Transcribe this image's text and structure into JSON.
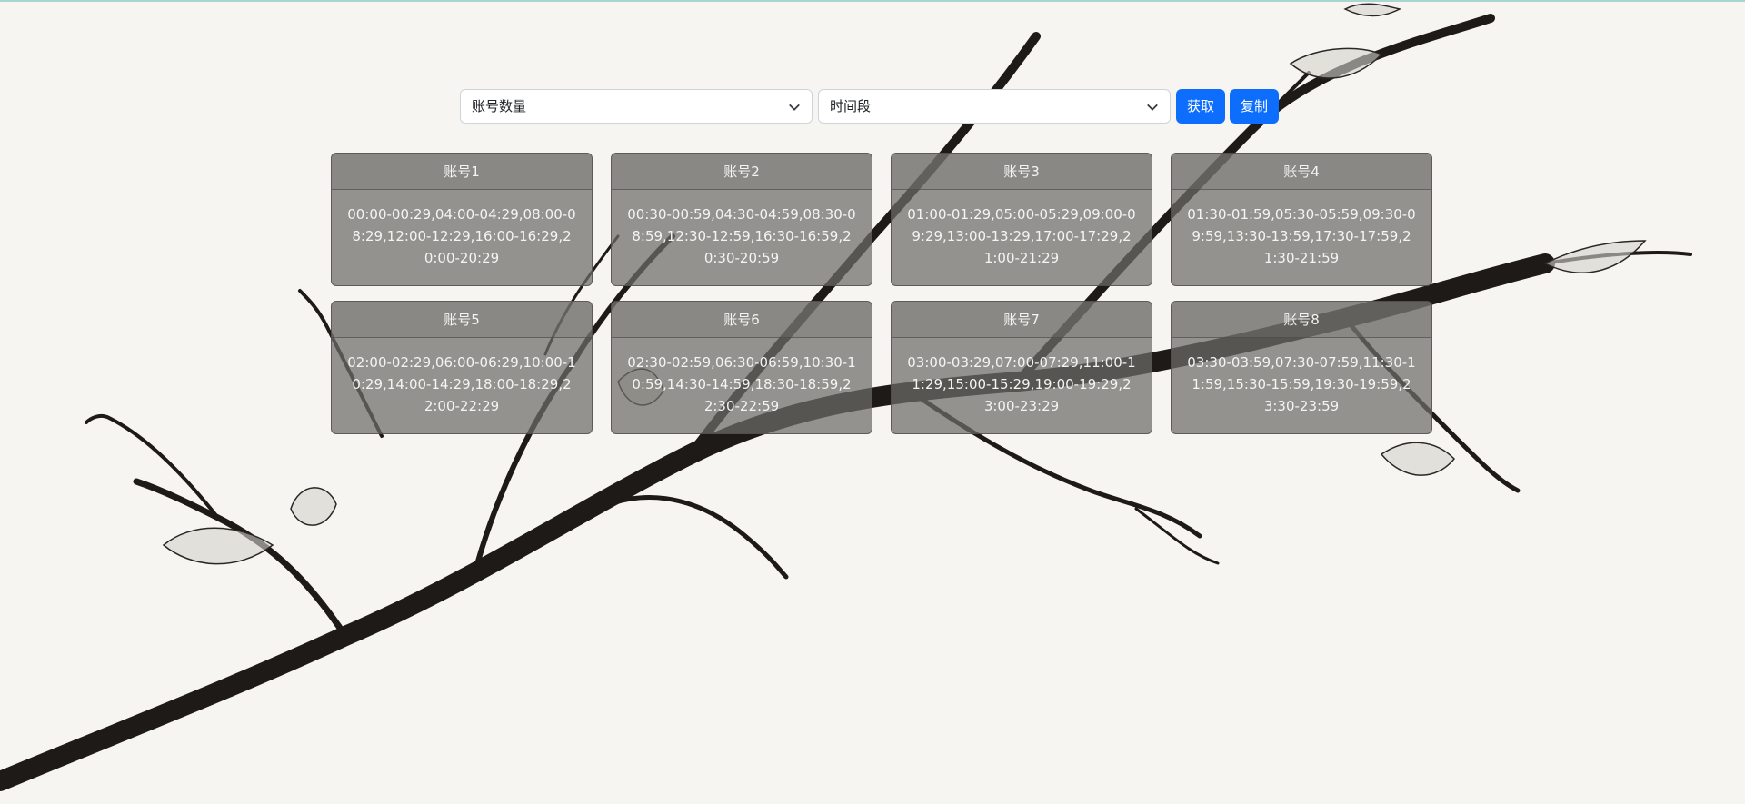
{
  "controls": {
    "account_count_select": "账号数量",
    "time_period_select": "时间段",
    "fetch_button": "获取",
    "copy_button": "复制"
  },
  "accounts": [
    {
      "title": "账号1",
      "times": "00:00-00:29,04:00-04:29,08:00-08:29,12:00-12:29,16:00-16:29,20:00-20:29"
    },
    {
      "title": "账号2",
      "times": "00:30-00:59,04:30-04:59,08:30-08:59,12:30-12:59,16:30-16:59,20:30-20:59"
    },
    {
      "title": "账号3",
      "times": "01:00-01:29,05:00-05:29,09:00-09:29,13:00-13:29,17:00-17:29,21:00-21:29"
    },
    {
      "title": "账号4",
      "times": "01:30-01:59,05:30-05:59,09:30-09:59,13:30-13:59,17:30-17:59,21:30-21:59"
    },
    {
      "title": "账号5",
      "times": "02:00-02:29,06:00-06:29,10:00-10:29,14:00-14:29,18:00-18:29,22:00-22:29"
    },
    {
      "title": "账号6",
      "times": "02:30-02:59,06:30-06:59,10:30-10:59,14:30-14:59,18:30-18:59,22:30-22:59"
    },
    {
      "title": "账号7",
      "times": "03:00-03:29,07:00-07:29,11:00-11:29,15:00-15:29,19:00-19:29,23:00-23:29"
    },
    {
      "title": "账号8",
      "times": "03:30-03:59,07:30-07:59,11:30-11:59,15:30-15:59,19:30-19:59,23:30-23:59"
    }
  ],
  "colors": {
    "primary": "#0d6efd",
    "card_bg": "#7a7874",
    "background": "#f7f5f1"
  }
}
